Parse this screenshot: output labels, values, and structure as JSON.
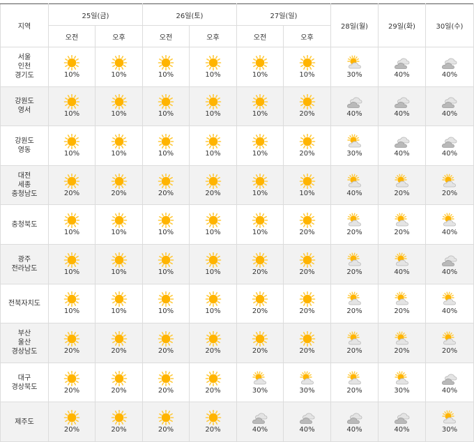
{
  "header": {
    "region_label": "지역",
    "day1": "25일(금)",
    "day2": "26일(토)",
    "day3": "27일(일)",
    "day4": "28일(월)",
    "day5": "29일(화)",
    "day6": "30일(수)",
    "am": "오전",
    "pm": "오후"
  },
  "rows": [
    {
      "region": [
        "서울",
        "인천",
        "경기도"
      ],
      "cells": [
        {
          "icon": "sunny-icon",
          "pct": "10%"
        },
        {
          "icon": "sunny-icon",
          "pct": "10%"
        },
        {
          "icon": "sunny-icon",
          "pct": "10%"
        },
        {
          "icon": "sunny-icon",
          "pct": "10%"
        },
        {
          "icon": "sunny-icon",
          "pct": "10%"
        },
        {
          "icon": "sunny-icon",
          "pct": "10%"
        },
        {
          "icon": "partly-cloudy-icon",
          "pct": "30%"
        },
        {
          "icon": "cloudy-icon",
          "pct": "40%"
        },
        {
          "icon": "cloudy-icon",
          "pct": "40%"
        }
      ]
    },
    {
      "region": [
        "강원도",
        "영서"
      ],
      "cells": [
        {
          "icon": "sunny-icon",
          "pct": "10%"
        },
        {
          "icon": "sunny-icon",
          "pct": "10%"
        },
        {
          "icon": "sunny-icon",
          "pct": "10%"
        },
        {
          "icon": "sunny-icon",
          "pct": "10%"
        },
        {
          "icon": "sunny-icon",
          "pct": "10%"
        },
        {
          "icon": "sunny-icon",
          "pct": "20%"
        },
        {
          "icon": "cloudy-icon",
          "pct": "40%"
        },
        {
          "icon": "cloudy-icon",
          "pct": "40%"
        },
        {
          "icon": "cloudy-icon",
          "pct": "40%"
        }
      ]
    },
    {
      "region": [
        "강원도",
        "영동"
      ],
      "cells": [
        {
          "icon": "sunny-icon",
          "pct": "10%"
        },
        {
          "icon": "sunny-icon",
          "pct": "10%"
        },
        {
          "icon": "sunny-icon",
          "pct": "10%"
        },
        {
          "icon": "sunny-icon",
          "pct": "10%"
        },
        {
          "icon": "sunny-icon",
          "pct": "10%"
        },
        {
          "icon": "sunny-icon",
          "pct": "20%"
        },
        {
          "icon": "partly-cloudy-icon",
          "pct": "30%"
        },
        {
          "icon": "cloudy-icon",
          "pct": "40%"
        },
        {
          "icon": "cloudy-icon",
          "pct": "40%"
        }
      ]
    },
    {
      "region": [
        "대전",
        "세종",
        "충청남도"
      ],
      "cells": [
        {
          "icon": "sunny-icon",
          "pct": "20%"
        },
        {
          "icon": "sunny-icon",
          "pct": "20%"
        },
        {
          "icon": "sunny-icon",
          "pct": "20%"
        },
        {
          "icon": "sunny-icon",
          "pct": "20%"
        },
        {
          "icon": "sunny-icon",
          "pct": "10%"
        },
        {
          "icon": "sunny-icon",
          "pct": "10%"
        },
        {
          "icon": "partly-cloudy-icon",
          "pct": "40%"
        },
        {
          "icon": "partly-cloudy-icon",
          "pct": "20%"
        },
        {
          "icon": "partly-cloudy-icon",
          "pct": "20%"
        }
      ]
    },
    {
      "region": [
        "충청북도"
      ],
      "cells": [
        {
          "icon": "sunny-icon",
          "pct": "10%"
        },
        {
          "icon": "sunny-icon",
          "pct": "10%"
        },
        {
          "icon": "sunny-icon",
          "pct": "10%"
        },
        {
          "icon": "sunny-icon",
          "pct": "10%"
        },
        {
          "icon": "sunny-icon",
          "pct": "10%"
        },
        {
          "icon": "sunny-icon",
          "pct": "20%"
        },
        {
          "icon": "partly-cloudy-icon",
          "pct": "20%"
        },
        {
          "icon": "partly-cloudy-icon",
          "pct": "20%"
        },
        {
          "icon": "partly-cloudy-icon",
          "pct": "40%"
        }
      ]
    },
    {
      "region": [
        "광주",
        "전라남도"
      ],
      "cells": [
        {
          "icon": "sunny-icon",
          "pct": "10%"
        },
        {
          "icon": "sunny-icon",
          "pct": "10%"
        },
        {
          "icon": "sunny-icon",
          "pct": "10%"
        },
        {
          "icon": "sunny-icon",
          "pct": "10%"
        },
        {
          "icon": "sunny-icon",
          "pct": "20%"
        },
        {
          "icon": "sunny-icon",
          "pct": "20%"
        },
        {
          "icon": "partly-cloudy-icon",
          "pct": "20%"
        },
        {
          "icon": "partly-cloudy-icon",
          "pct": "40%"
        },
        {
          "icon": "cloudy-icon",
          "pct": "40%"
        }
      ]
    },
    {
      "region": [
        "전북자치도"
      ],
      "cells": [
        {
          "icon": "sunny-icon",
          "pct": "10%"
        },
        {
          "icon": "sunny-icon",
          "pct": "10%"
        },
        {
          "icon": "sunny-icon",
          "pct": "10%"
        },
        {
          "icon": "sunny-icon",
          "pct": "10%"
        },
        {
          "icon": "sunny-icon",
          "pct": "20%"
        },
        {
          "icon": "sunny-icon",
          "pct": "20%"
        },
        {
          "icon": "partly-cloudy-icon",
          "pct": "20%"
        },
        {
          "icon": "partly-cloudy-icon",
          "pct": "20%"
        },
        {
          "icon": "partly-cloudy-icon",
          "pct": "40%"
        }
      ]
    },
    {
      "region": [
        "부산",
        "울산",
        "경상남도"
      ],
      "cells": [
        {
          "icon": "sunny-icon",
          "pct": "20%"
        },
        {
          "icon": "sunny-icon",
          "pct": "20%"
        },
        {
          "icon": "sunny-icon",
          "pct": "20%"
        },
        {
          "icon": "sunny-icon",
          "pct": "20%"
        },
        {
          "icon": "sunny-icon",
          "pct": "20%"
        },
        {
          "icon": "sunny-icon",
          "pct": "20%"
        },
        {
          "icon": "partly-cloudy-icon",
          "pct": "20%"
        },
        {
          "icon": "partly-cloudy-icon",
          "pct": "20%"
        },
        {
          "icon": "partly-cloudy-icon",
          "pct": "20%"
        }
      ]
    },
    {
      "region": [
        "대구",
        "경상북도"
      ],
      "cells": [
        {
          "icon": "sunny-icon",
          "pct": "20%"
        },
        {
          "icon": "sunny-icon",
          "pct": "20%"
        },
        {
          "icon": "sunny-icon",
          "pct": "20%"
        },
        {
          "icon": "sunny-icon",
          "pct": "20%"
        },
        {
          "icon": "partly-cloudy-icon",
          "pct": "30%"
        },
        {
          "icon": "partly-cloudy-icon",
          "pct": "30%"
        },
        {
          "icon": "partly-cloudy-icon",
          "pct": "20%"
        },
        {
          "icon": "partly-cloudy-icon",
          "pct": "30%"
        },
        {
          "icon": "cloudy-icon",
          "pct": "40%"
        }
      ]
    },
    {
      "region": [
        "제주도"
      ],
      "cells": [
        {
          "icon": "sunny-icon",
          "pct": "20%"
        },
        {
          "icon": "sunny-icon",
          "pct": "20%"
        },
        {
          "icon": "sunny-icon",
          "pct": "20%"
        },
        {
          "icon": "sunny-icon",
          "pct": "20%"
        },
        {
          "icon": "cloudy-icon",
          "pct": "40%"
        },
        {
          "icon": "cloudy-icon",
          "pct": "40%"
        },
        {
          "icon": "cloudy-icon",
          "pct": "40%"
        },
        {
          "icon": "cloudy-icon",
          "pct": "40%"
        },
        {
          "icon": "partly-cloudy-icon",
          "pct": "30%"
        }
      ]
    }
  ],
  "colors": {
    "sun": "#ffb400",
    "sun_ray": "#ffc93a",
    "cloud": "#b9b9b9",
    "cloud_light": "#e4e4e4",
    "border_top": "#555555",
    "alt_row": "#f2f2f2"
  }
}
